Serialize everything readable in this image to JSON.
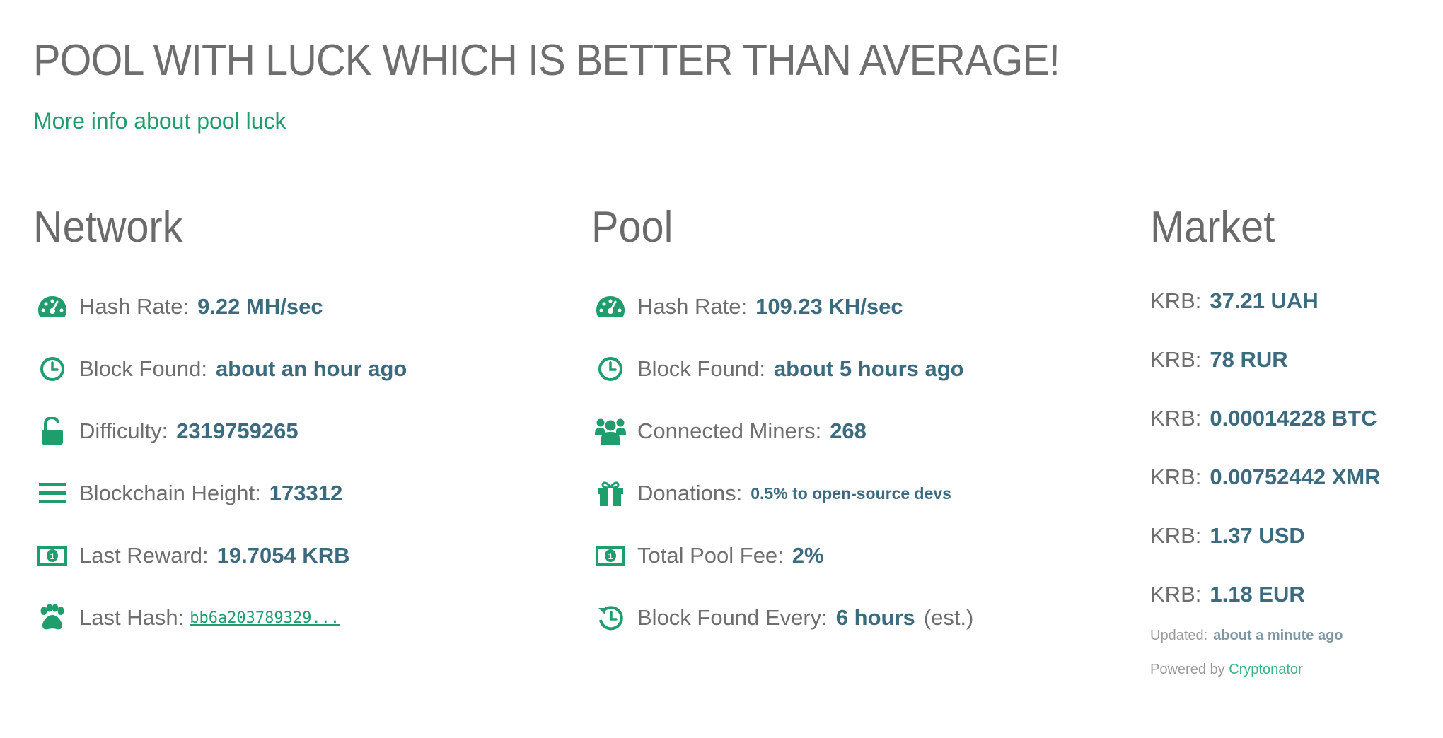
{
  "header": {
    "title": "POOL WITH LUCK WHICH IS BETTER THAN AVERAGE!",
    "luck_link": "More info about pool luck"
  },
  "network": {
    "heading": "Network",
    "hash_rate": {
      "icon": "dashboard-icon",
      "label": "Hash Rate:",
      "value": "9.22 MH/sec"
    },
    "block_found": {
      "icon": "clock-icon",
      "label": "Block Found:",
      "value": "about an hour ago"
    },
    "difficulty": {
      "icon": "unlock-icon",
      "label": "Difficulty:",
      "value": "2319759265"
    },
    "height": {
      "icon": "bars-icon",
      "label": "Blockchain Height:",
      "value": "173312"
    },
    "last_reward": {
      "icon": "money-icon",
      "label": "Last Reward:",
      "value": "19.7054 KRB"
    },
    "last_hash": {
      "icon": "paw-icon",
      "label": "Last Hash:",
      "value": "bb6a203789329..."
    }
  },
  "pool": {
    "heading": "Pool",
    "hash_rate": {
      "icon": "dashboard-icon",
      "label": "Hash Rate:",
      "value": "109.23 KH/sec"
    },
    "block_found": {
      "icon": "clock-icon",
      "label": "Block Found:",
      "value": "about 5 hours ago"
    },
    "miners": {
      "icon": "users-icon",
      "label": "Connected Miners:",
      "value": "268"
    },
    "donations": {
      "icon": "gift-icon",
      "label": "Donations:",
      "value": "0.5% to open-source devs"
    },
    "fee": {
      "icon": "money-icon",
      "label": "Total Pool Fee:",
      "value": "2%"
    },
    "block_every": {
      "icon": "history-icon",
      "label": "Block Found Every:",
      "value": "6 hours",
      "suffix": "(est.)"
    }
  },
  "market": {
    "heading": "Market",
    "rates": [
      {
        "label": "KRB:",
        "value": "37.21 UAH"
      },
      {
        "label": "KRB:",
        "value": "78 RUR"
      },
      {
        "label": "KRB:",
        "value": "0.00014228 BTC"
      },
      {
        "label": "KRB:",
        "value": "0.00752442 XMR"
      },
      {
        "label": "KRB:",
        "value": "1.37 USD"
      },
      {
        "label": "KRB:",
        "value": "1.18 EUR"
      }
    ],
    "updated_label": "Updated:",
    "updated_value": "about a minute ago",
    "powered_prefix": "Powered by",
    "powered_link": "Cryptonator"
  },
  "colors": {
    "accent": "#1e9e6d",
    "value": "#3c6a7f",
    "text": "#6e6e6e"
  }
}
